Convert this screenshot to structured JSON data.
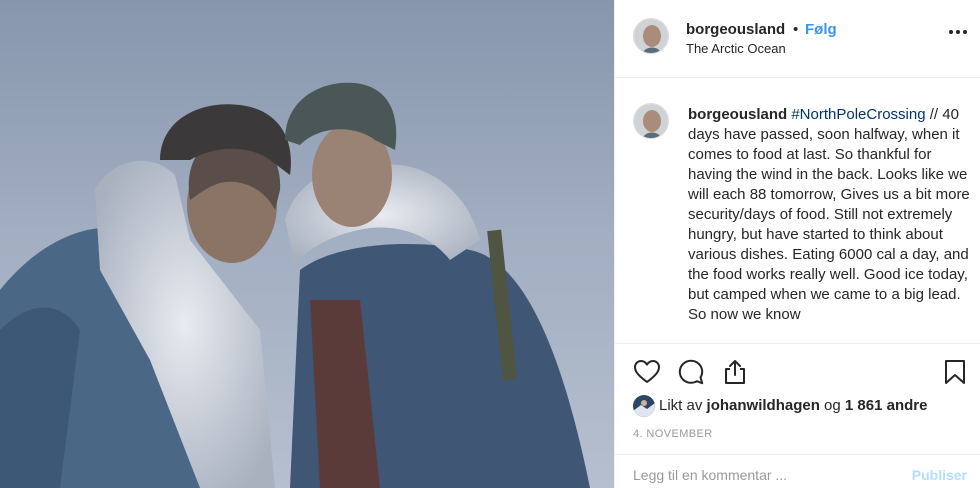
{
  "post": {
    "username": "borgeousland",
    "separator": "•",
    "follow_label": "Følg",
    "location": "The Arctic Ocean"
  },
  "caption": {
    "username": "borgeousland",
    "hashtag": "#NorthPoleCrossing",
    "text": " // 40 days have passed, soon halfway, when it comes to food at last. So thankful for having the wind in the back. Looks like we will each 88 tomorrow, Gives us a bit more security/days of food. Still not extremely hungry, but have started to think about various dishes. Eating 6000 cal a day, and the food works really well. Good ice today, but camped when we came to a big lead. So now we know"
  },
  "likes": {
    "prefix": "Likt av",
    "user": "johanwildhagen",
    "conjunction": "og",
    "count": "1 861 andre"
  },
  "date": "4. NOVEMBER",
  "comment": {
    "placeholder": "Legg til en kommentar ...",
    "publish_label": "Publiser"
  },
  "icons": {
    "like": "heart-icon",
    "comment": "speech-bubble-icon",
    "share": "share-icon",
    "save": "bookmark-icon",
    "more": "more-options-icon"
  },
  "colors": {
    "link": "#3897f0",
    "hashtag": "#003569",
    "publish_disabled": "#b2dffc",
    "muted": "#999999"
  }
}
